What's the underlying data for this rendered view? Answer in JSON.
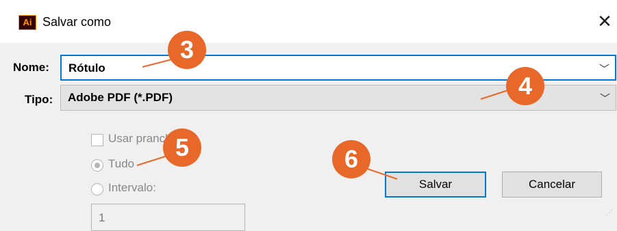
{
  "window": {
    "title": "Salvar como",
    "app_icon_text": "Ai",
    "close_glyph": "✕"
  },
  "form": {
    "nome_label": "Nome:",
    "nome_value": "Rótulo",
    "tipo_label": "Tipo:",
    "tipo_value": "Adobe PDF (*.PDF)",
    "usar_label": "Usar pranchetas",
    "usar_checked": false,
    "tudo_label": "Tudo",
    "tudo_selected": true,
    "intervalo_label": "Intervalo:",
    "intervalo_value": "1"
  },
  "buttons": {
    "save_label": "Salvar",
    "cancel_label": "Cancelar"
  },
  "callouts": [
    "3",
    "4",
    "5",
    "6"
  ],
  "colors": {
    "callout": "#e8682a",
    "focus_border": "#0078d7",
    "dialog_bg": "#f0f0f0"
  },
  "icons": [
    "adobe-illustrator-icon",
    "close-icon",
    "chevron-down-icon",
    "chevron-down-icon"
  ]
}
